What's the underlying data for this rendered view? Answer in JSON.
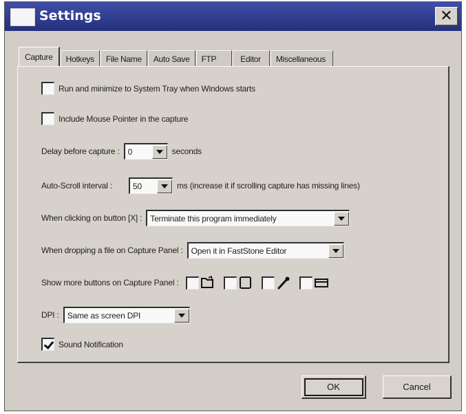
{
  "window": {
    "title": "Settings",
    "close_glyph": "✕"
  },
  "tabs": [
    {
      "label": "Capture",
      "active": true
    },
    {
      "label": "Hotkeys"
    },
    {
      "label": "File Name"
    },
    {
      "label": "Auto Save"
    },
    {
      "label": "FTP"
    },
    {
      "label": "Editor"
    },
    {
      "label": "Miscellaneous"
    }
  ],
  "capture": {
    "run_minimize": {
      "label": "Run and minimize to System Tray when Windows starts",
      "checked": false
    },
    "include_pointer": {
      "label": "Include Mouse Pointer in the capture",
      "checked": false
    },
    "delay": {
      "label": "Delay before capture :",
      "value": "0",
      "suffix": "seconds"
    },
    "autoscroll": {
      "label": "Auto-Scroll interval :",
      "value": "50",
      "suffix": "ms (increase it if scrolling capture has missing lines)"
    },
    "clicking_x": {
      "label": "When clicking on button [X] :",
      "value": "Terminate this program immediately"
    },
    "dropping_file": {
      "label": "When dropping a file on Capture Panel :",
      "value": "Open it in FastStone Editor"
    },
    "more_buttons": {
      "label": "Show more buttons on Capture Panel :",
      "icons": [
        "open-file-icon",
        "window-icon",
        "color-picker-icon",
        "screen-ruler-icon"
      ]
    },
    "dpi": {
      "label": "DPI :",
      "value": "Same as screen DPI"
    },
    "sound": {
      "label": "Sound Notification",
      "checked": true
    }
  },
  "buttons": {
    "ok": "OK",
    "cancel": "Cancel"
  }
}
